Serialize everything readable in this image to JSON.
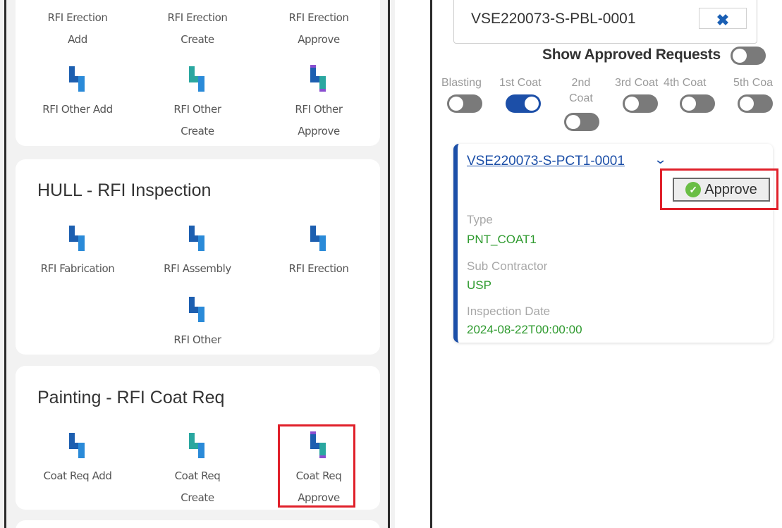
{
  "left": {
    "card1": {
      "tiles": [
        {
          "label1": "RFI Erection",
          "label2": "Add"
        },
        {
          "label1": "RFI Erection",
          "label2": "Create"
        },
        {
          "label1": "RFI Erection",
          "label2": "Approve"
        },
        {
          "label1": "RFI Other Add",
          "label2": ""
        },
        {
          "label1": "RFI Other",
          "label2": "Create"
        },
        {
          "label1": "RFI Other",
          "label2": "Approve"
        }
      ]
    },
    "card2": {
      "title": "HULL - RFI Inspection",
      "tiles": [
        {
          "label1": "RFI Fabrication"
        },
        {
          "label1": "RFI Assembly"
        },
        {
          "label1": "RFI Erection"
        },
        {
          "label1": "RFI Other"
        }
      ]
    },
    "card3": {
      "title": "Painting - RFI Coat Req",
      "tiles": [
        {
          "label1": "Coat Req Add",
          "label2": ""
        },
        {
          "label1": "Coat Req",
          "label2": "Create"
        },
        {
          "label1": "Coat Req",
          "label2": "Approve"
        }
      ]
    }
  },
  "right": {
    "search_value": "VSE220073-S-PBL-0001",
    "clear_symbol": "✖",
    "show_approved_label": "Show Approved Requests",
    "coats": [
      {
        "label": "Blasting",
        "on": false
      },
      {
        "label": "1st Coat",
        "on": true
      },
      {
        "label1": "2nd",
        "label2": "Coat",
        "on": false
      },
      {
        "label": "3rd Coat",
        "on": false
      },
      {
        "label": "4th Coat",
        "on": false
      },
      {
        "label": "5th Coa",
        "on": false
      }
    ],
    "request": {
      "id": "VSE220073-S-PCT1-0001",
      "chevron": "⌄",
      "approve_label": "Approve",
      "type_label": "Type",
      "type_value": "PNT_COAT1",
      "sub_label": "Sub Contractor",
      "sub_value": "USP",
      "date_label": "Inspection Date",
      "date_value": "2024-08-22T00:00:00"
    }
  },
  "colors": {
    "accent_blue": "#1c4fa8",
    "highlight_red": "#e0202a",
    "value_green": "#2e9a2e"
  },
  "icons": {
    "tile_icon": "pipe-elbow-icon"
  }
}
